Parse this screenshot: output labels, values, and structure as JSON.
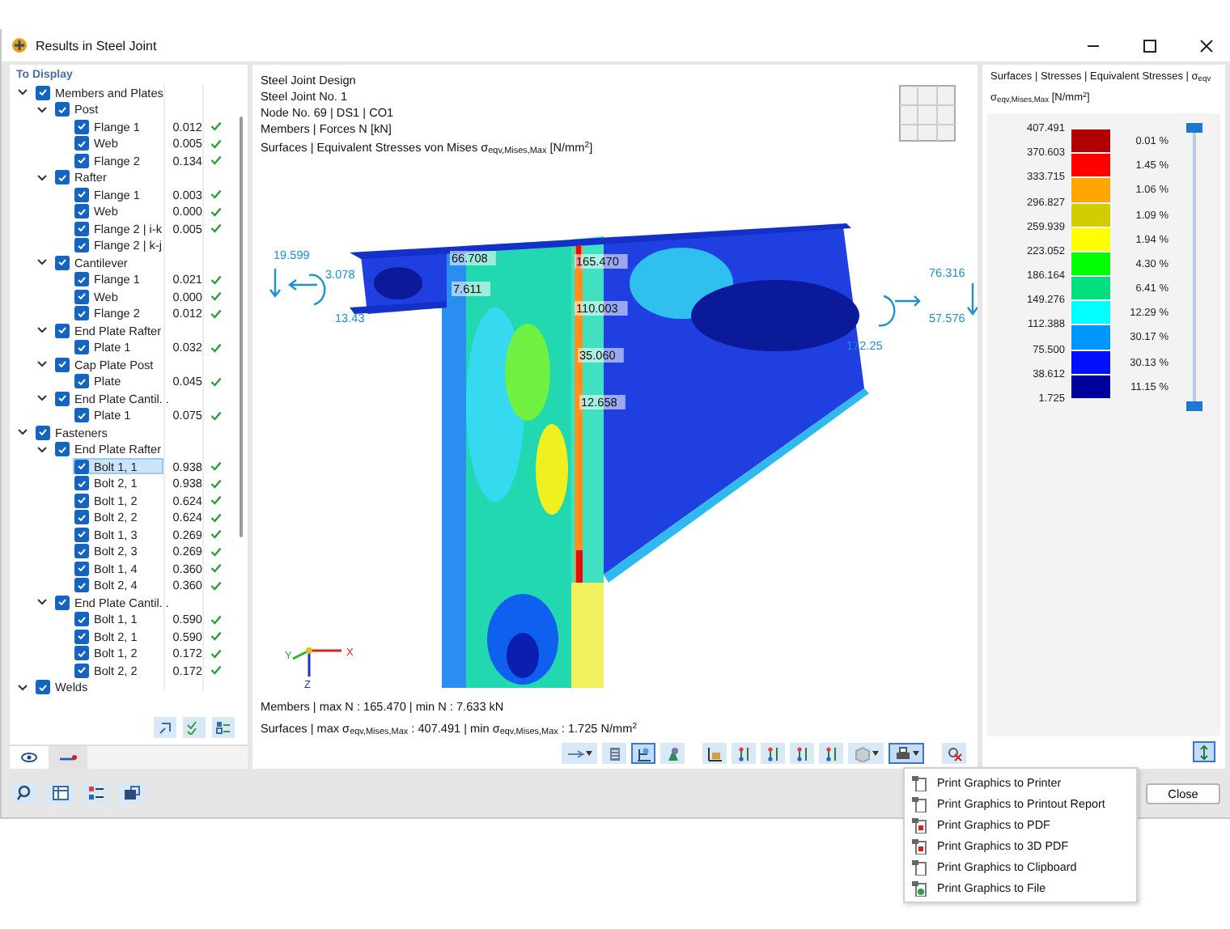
{
  "window": {
    "title": "Results in Steel Joint"
  },
  "tree": {
    "header": "To Display",
    "items": [
      {
        "label": "Members and Plates",
        "checked": true,
        "expanded": true,
        "selected": false,
        "children": [
          {
            "label": "Post",
            "checked": true,
            "expanded": true,
            "selected": false,
            "children": [
              {
                "label": "Flange 1",
                "checked": true,
                "selected": false,
                "value": "0.012",
                "ok": true
              },
              {
                "label": "Web",
                "checked": true,
                "selected": false,
                "value": "0.005",
                "ok": true
              },
              {
                "label": "Flange 2",
                "checked": true,
                "selected": false,
                "value": "0.134",
                "ok": true
              }
            ]
          },
          {
            "label": "Rafter",
            "checked": true,
            "expanded": true,
            "selected": false,
            "children": [
              {
                "label": "Flange 1",
                "checked": true,
                "selected": false,
                "value": "0.003",
                "ok": true
              },
              {
                "label": "Web",
                "checked": true,
                "selected": false,
                "value": "0.000",
                "ok": true
              },
              {
                "label": "Flange 2 | i-k",
                "checked": true,
                "selected": false,
                "value": "0.005",
                "ok": true
              },
              {
                "label": "Flange 2 | k-j",
                "checked": true,
                "selected": false,
                "ok": false
              }
            ]
          },
          {
            "label": "Cantilever",
            "checked": true,
            "expanded": true,
            "selected": false,
            "children": [
              {
                "label": "Flange 1",
                "checked": true,
                "selected": false,
                "value": "0.021",
                "ok": true
              },
              {
                "label": "Web",
                "checked": true,
                "selected": false,
                "value": "0.000",
                "ok": true
              },
              {
                "label": "Flange 2",
                "checked": true,
                "selected": false,
                "value": "0.012",
                "ok": true
              }
            ]
          },
          {
            "label": "End Plate Rafter",
            "checked": true,
            "expanded": true,
            "selected": false,
            "children": [
              {
                "label": "Plate 1",
                "checked": true,
                "selected": false,
                "value": "0.032",
                "ok": true
              }
            ]
          },
          {
            "label": "Cap Plate Post",
            "checked": true,
            "expanded": true,
            "selected": false,
            "children": [
              {
                "label": "Plate",
                "checked": true,
                "selected": false,
                "value": "0.045",
                "ok": true
              }
            ]
          },
          {
            "label": "End Plate Cantil...",
            "checked": true,
            "expanded": true,
            "selected": false,
            "children": [
              {
                "label": "Plate 1",
                "checked": true,
                "selected": false,
                "value": "0.075",
                "ok": true
              }
            ]
          }
        ]
      },
      {
        "label": "Fasteners",
        "checked": true,
        "expanded": true,
        "selected": false,
        "children": [
          {
            "label": "End Plate Rafter",
            "checked": true,
            "expanded": true,
            "selected": false,
            "children": [
              {
                "label": "Bolt 1, 1",
                "checked": true,
                "selected": true,
                "value": "0.938",
                "ok": true
              },
              {
                "label": "Bolt 2, 1",
                "checked": true,
                "selected": false,
                "value": "0.938",
                "ok": true
              },
              {
                "label": "Bolt 1, 2",
                "checked": true,
                "selected": false,
                "value": "0.624",
                "ok": true
              },
              {
                "label": "Bolt 2, 2",
                "checked": true,
                "selected": false,
                "value": "0.624",
                "ok": true
              },
              {
                "label": "Bolt 1, 3",
                "checked": true,
                "selected": false,
                "value": "0.269",
                "ok": true
              },
              {
                "label": "Bolt 2, 3",
                "checked": true,
                "selected": false,
                "value": "0.269",
                "ok": true
              },
              {
                "label": "Bolt 1, 4",
                "checked": true,
                "selected": false,
                "value": "0.360",
                "ok": true
              },
              {
                "label": "Bolt 2, 4",
                "checked": true,
                "selected": false,
                "value": "0.360",
                "ok": true
              }
            ]
          },
          {
            "label": "End Plate Cantil...",
            "checked": true,
            "expanded": true,
            "selected": false,
            "children": [
              {
                "label": "Bolt 1, 1",
                "checked": true,
                "selected": false,
                "value": "0.590",
                "ok": true
              },
              {
                "label": "Bolt 2, 1",
                "checked": true,
                "selected": false,
                "value": "0.590",
                "ok": true
              },
              {
                "label": "Bolt 1, 2",
                "checked": true,
                "selected": false,
                "value": "0.172",
                "ok": true
              },
              {
                "label": "Bolt 2, 2",
                "checked": true,
                "selected": false,
                "value": "0.172",
                "ok": true
              }
            ]
          }
        ]
      },
      {
        "label": "Welds",
        "checked": true,
        "expanded": true,
        "selected": false
      }
    ]
  },
  "panel_tabs": [
    {
      "selected": true
    },
    {
      "selected": false
    }
  ],
  "viewport": {
    "info_lines": [
      "Steel Joint Design",
      "Steel Joint No. 1",
      "Node No. 69 | DS1 | CO1",
      "Members | Forces N [kN]",
      "Surfaces | Equivalent Stresses von Mises σ$_{eqv,Mises,Max}$ [N/mm$^{2}$]"
    ],
    "model_labels": [
      "66.708",
      "7.611",
      "165.470",
      "110.003",
      "35.060",
      "12.658"
    ],
    "load_labels": [
      "19.599",
      "3.078",
      "13.43",
      "76.316",
      "57.576",
      "172.25"
    ],
    "axes": [
      "X",
      "Y",
      "Z"
    ],
    "summary_lines": [
      "Members | max N : 165.470 | min N : 7.633 kN",
      "Surfaces | max σ$_{eqv,Mises,Max}$ : 407.491 | min σ$_{eqv,Mises,Max}$ : 1.725 N/mm$^{2}$"
    ],
    "toolbar": [
      {
        "pressed": false,
        "dropdown": true
      },
      {
        "pressed": false,
        "dropdown": false
      },
      {
        "pressed": true,
        "dropdown": false
      },
      {
        "pressed": false,
        "dropdown": false
      },
      {
        "pressed": false,
        "dropdown": false
      },
      {
        "pressed": false,
        "dropdown": false
      },
      {
        "pressed": false,
        "dropdown": false
      },
      {
        "pressed": false,
        "dropdown": false
      },
      {
        "pressed": false,
        "dropdown": false
      },
      {
        "pressed": false,
        "dropdown": true
      },
      {
        "pressed": true,
        "dropdown": true
      },
      {
        "pressed": false,
        "dropdown": false
      }
    ]
  },
  "legend": {
    "title": "Surfaces | Stresses | Equivalent Stresses | σ$_{eqv}$ σ$_{eqv,Mises,Max}$ [N/mm$^{2}$]",
    "values": [
      "407.491",
      "370.603",
      "333.715",
      "296.827",
      "259.939",
      "223.052",
      "186.164",
      "149.276",
      "112.388",
      "75.500",
      "38.612",
      "1.725"
    ],
    "slider": {
      "level": 1
    },
    "bands": [
      {
        "color": "#b00000",
        "percent": "0.01 %"
      },
      {
        "color": "#ff0000",
        "percent": "1.45 %"
      },
      {
        "color": "#ffa500",
        "percent": "1.06 %"
      },
      {
        "color": "#d2cc00",
        "percent": "1.09 %"
      },
      {
        "color": "#ffff00",
        "percent": "1.94 %"
      },
      {
        "color": "#00ff00",
        "percent": "4.30 %"
      },
      {
        "color": "#00e080",
        "percent": "6.41 %"
      },
      {
        "color": "#00ffff",
        "percent": "12.29 %"
      },
      {
        "color": "#0096ff",
        "percent": "30.17 %"
      },
      {
        "color": "#0010ff",
        "percent": "30.13 %"
      },
      {
        "color": "#00009c",
        "percent": "11.15 %"
      }
    ]
  },
  "close_button": "Close",
  "print_menu": [
    "Print Graphics to Printer",
    "Print Graphics to Printout Report",
    "Print Graphics to PDF",
    "Print Graphics to 3D PDF",
    "Print Graphics to Clipboard",
    "Print Graphics to File"
  ]
}
